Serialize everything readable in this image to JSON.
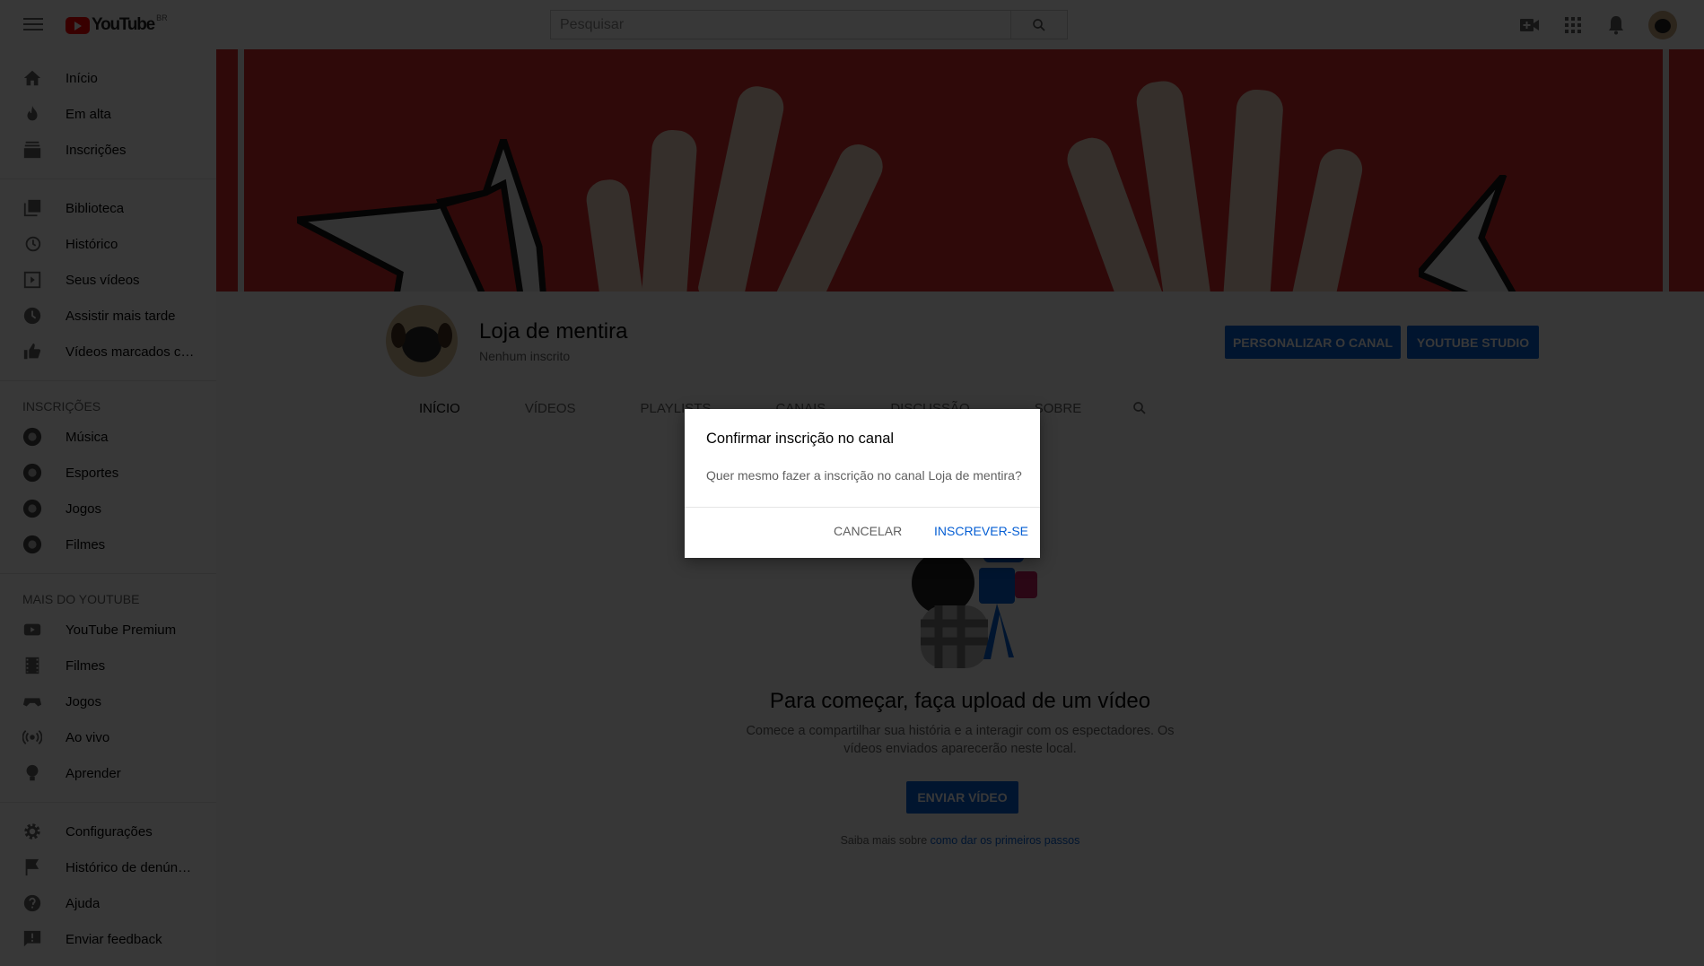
{
  "topbar": {
    "logo_text": "YouTube",
    "logo_country": "BR",
    "search_placeholder": "Pesquisar"
  },
  "sidebar": {
    "main": [
      {
        "label": "Início",
        "icon": "home-icon"
      },
      {
        "label": "Em alta",
        "icon": "flame-icon"
      },
      {
        "label": "Inscrições",
        "icon": "subscriptions-icon"
      }
    ],
    "library": [
      {
        "label": "Biblioteca",
        "icon": "library-icon"
      },
      {
        "label": "Histórico",
        "icon": "history-icon"
      },
      {
        "label": "Seus vídeos",
        "icon": "your-videos-icon"
      },
      {
        "label": "Assistir mais tarde",
        "icon": "clock-icon"
      },
      {
        "label": "Vídeos marcados com \"Gostei\"",
        "icon": "thumbs-up-icon"
      }
    ],
    "subscriptions_header": "INSCRIÇÕES",
    "subscriptions": [
      {
        "label": "Música",
        "icon": "music-channel-icon"
      },
      {
        "label": "Esportes",
        "icon": "sports-channel-icon"
      },
      {
        "label": "Jogos",
        "icon": "gaming-channel-icon"
      },
      {
        "label": "Filmes",
        "icon": "movies-channel-icon"
      }
    ],
    "more_header": "MAIS DO YOUTUBE",
    "more": [
      {
        "label": "YouTube Premium",
        "icon": "youtube-icon"
      },
      {
        "label": "Filmes",
        "icon": "film-icon"
      },
      {
        "label": "Jogos",
        "icon": "gamepad-icon"
      },
      {
        "label": "Ao vivo",
        "icon": "live-icon"
      },
      {
        "label": "Aprender",
        "icon": "lightbulb-icon"
      }
    ],
    "settings": [
      {
        "label": "Configurações",
        "icon": "gear-icon"
      },
      {
        "label": "Histórico de denúncias",
        "icon": "flag-icon"
      },
      {
        "label": "Ajuda",
        "icon": "help-icon"
      },
      {
        "label": "Enviar feedback",
        "icon": "feedback-icon"
      }
    ]
  },
  "channel": {
    "name": "Loja de mentira",
    "subscribers": "Nenhum inscrito",
    "customize_label": "PERSONALIZAR O CANAL",
    "studio_label": "YOUTUBE STUDIO",
    "tabs": [
      "INÍCIO",
      "VÍDEOS",
      "PLAYLISTS",
      "CANAIS",
      "DISCUSSÃO",
      "SOBRE"
    ],
    "active_tab": "INÍCIO"
  },
  "empty": {
    "title": "Para começar, faça upload de um vídeo",
    "desc": "Comece a compartilhar sua história e a interagir com os espectadores. Os vídeos enviados aparecerão neste local.",
    "upload_label": "ENVIAR VÍDEO",
    "learn_prefix": "Saiba mais sobre ",
    "learn_link": "como dar os primeiros passos"
  },
  "dialog": {
    "title": "Confirmar inscrição no canal",
    "body": "Quer mesmo fazer a inscrição no canal Loja de mentira?",
    "cancel": "CANCELAR",
    "confirm": "INSCREVER-SE"
  },
  "colors": {
    "accent": "#065fd4",
    "banner": "#d72b2b",
    "logo_red": "#ff0000"
  }
}
